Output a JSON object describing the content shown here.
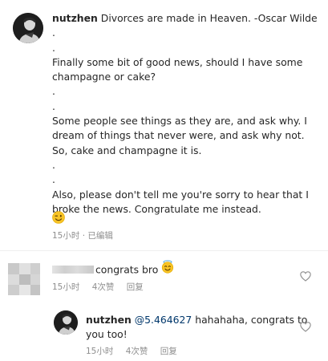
{
  "post": {
    "username": "nutzhen",
    "lines": [
      "Divorces are made in Heaven. -Oscar Wilde",
      ".",
      ".",
      "Finally some bit of good news, should I have some",
      "champagne or cake?",
      ".",
      ".",
      "Some people see things as they are, and ask why. I",
      "dream of things that never were, and ask why not.",
      "So, cake and champagne it is.",
      ".",
      ".",
      "Also, please don't tell me you're sorry to hear that I",
      "broke the news. Congratulate me instead."
    ],
    "emoji_icon": "wink-face-emoji",
    "meta": "15小时 · 已编辑"
  },
  "comment1": {
    "text": "congrats bro",
    "emoji_icon": "smiling-face-with-halo-emoji",
    "time": "15小时",
    "likes": "4次赞",
    "reply_label": "回复"
  },
  "reply1": {
    "username": "nutzhen",
    "mention": "@5.464627",
    "text_line1": " hahahaha, congrats to",
    "text_line2": "you too!",
    "time": "15小时",
    "likes": "4次赞",
    "reply_label": "回复"
  },
  "colors": {
    "text": "#262626",
    "meta": "#8e8e8e",
    "mention": "#00376b",
    "emoji": "#f7c325",
    "divider": "#efefef"
  }
}
